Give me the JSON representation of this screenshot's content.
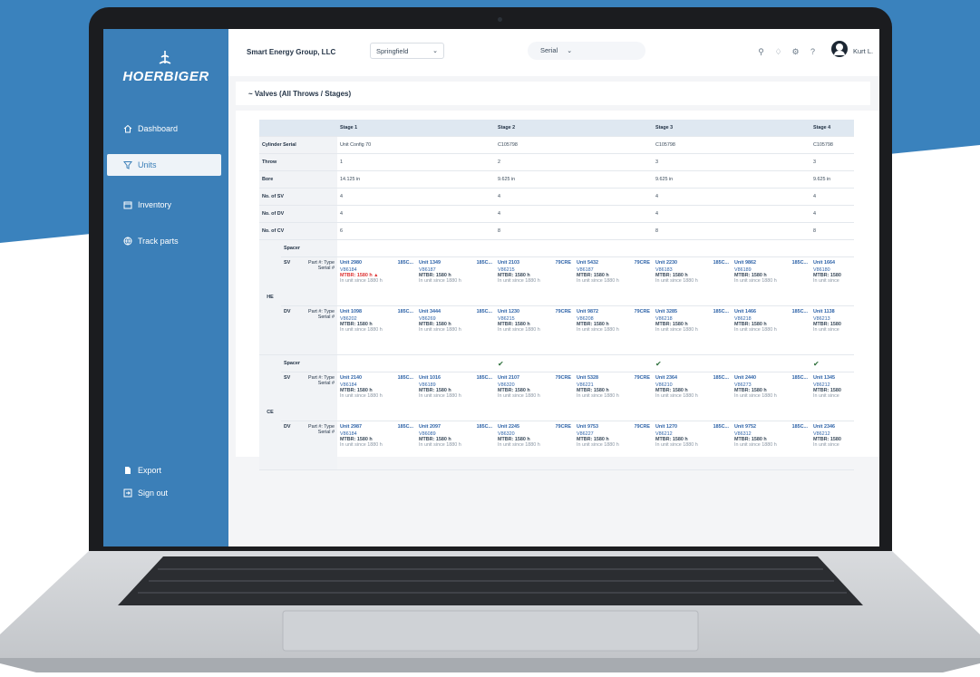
{
  "brand": {
    "name": "HOERBIGER"
  },
  "sidebar": {
    "items": [
      {
        "label": "Dashboard",
        "icon": "home-icon",
        "active": false
      },
      {
        "label": "Units",
        "icon": "filter-icon",
        "active": true
      },
      {
        "label": "Inventory",
        "icon": "calendar-icon",
        "active": false
      },
      {
        "label": "Track parts",
        "icon": "globe-icon",
        "active": false
      }
    ],
    "bottom": [
      {
        "label": "Export",
        "icon": "document-icon"
      },
      {
        "label": "Sign out",
        "icon": "sign-out-icon"
      }
    ]
  },
  "header": {
    "company": "Smart Energy Group, LLC",
    "location": "Springfield",
    "search_label": "Serial",
    "user_name": "Kurt L."
  },
  "section": {
    "title": "~ Valves (All Throws / Stages)"
  },
  "table": {
    "stages": [
      "Stage 1",
      "Stage 2",
      "Stage 3",
      "Stage 4"
    ],
    "rows": [
      {
        "label": "Cylinder Serial",
        "values": [
          "Unit Config 70",
          "C105798",
          "C105798",
          "C105798"
        ]
      },
      {
        "label": "Throw",
        "values": [
          "1",
          "2",
          "3",
          "3"
        ]
      },
      {
        "label": "Bore",
        "values": [
          "14.125 in",
          "9.625 in",
          "9.625 in",
          "9.625 in"
        ]
      },
      {
        "label": "No. of SV",
        "values": [
          "4",
          "4",
          "4",
          "4"
        ]
      },
      {
        "label": "No. of DV",
        "values": [
          "4",
          "4",
          "4",
          "4"
        ]
      },
      {
        "label": "No. of CV",
        "values": [
          "6",
          "8",
          "8",
          "8"
        ]
      }
    ],
    "spacer_label": "Spacer",
    "ends": [
      {
        "end": "HE",
        "spacer_checks": [
          false,
          false,
          false,
          false,
          false,
          false,
          false
        ],
        "valves": [
          {
            "type": "SV",
            "part_label": "Part #: Type",
            "serial_label": "Serial #",
            "cells": [
              {
                "unit": "Unit 2980",
                "code": "185C...",
                "serial": "V86184",
                "mtbr": "MTBR: 1580 h",
                "warn": true,
                "since": "In unit since 1880 h"
              },
              {
                "unit": "Unit 1349",
                "code": "185C...",
                "serial": "V86187",
                "mtbr": "MTBR: 1580 h",
                "warn": false,
                "since": "In unit since 1880 h"
              },
              {
                "unit": "Unit 2103",
                "code": "79CRE",
                "serial": "V86215",
                "mtbr": "MTBR: 1580 h",
                "warn": false,
                "since": "In unit since 1880 h"
              },
              {
                "unit": "Unit 5432",
                "code": "79CRE",
                "serial": "V86187",
                "mtbr": "MTBR: 1580 h",
                "warn": false,
                "since": "In unit since 1880 h"
              },
              {
                "unit": "Unit 2230",
                "code": "185C...",
                "serial": "V86183",
                "mtbr": "MTBR: 1580 h",
                "warn": false,
                "since": "In unit since 1880 h"
              },
              {
                "unit": "Unit 9862",
                "code": "185C...",
                "serial": "V86189",
                "mtbr": "MTBR: 1580 h",
                "warn": false,
                "since": "In unit since 1880 h"
              },
              {
                "unit": "Unit 1664",
                "code": "",
                "serial": "V86180",
                "mtbr": "MTBR: 1580",
                "warn": false,
                "since": "In unit since"
              }
            ]
          },
          {
            "type": "DV",
            "part_label": "Part #: Type",
            "serial_label": "Serial #",
            "cells": [
              {
                "unit": "Unit 1098",
                "code": "185C...",
                "serial": "V86202",
                "mtbr": "MTBR: 1580 h",
                "warn": false,
                "since": "In unit since 1880 h"
              },
              {
                "unit": "Unit 3444",
                "code": "185C...",
                "serial": "V86269",
                "mtbr": "MTBR: 1580 h",
                "warn": false,
                "since": "In unit since 1880 h"
              },
              {
                "unit": "Unit 1230",
                "code": "79CRE",
                "serial": "V86215",
                "mtbr": "MTBR: 1580 h",
                "warn": false,
                "since": "In unit since 1880 h"
              },
              {
                "unit": "Unit 9872",
                "code": "79CRE",
                "serial": "V86208",
                "mtbr": "MTBR: 1580 h",
                "warn": false,
                "since": "In unit since 1880 h"
              },
              {
                "unit": "Unit 3285",
                "code": "185C...",
                "serial": "V86218",
                "mtbr": "MTBR: 1580 h",
                "warn": false,
                "since": "In unit since 1880 h"
              },
              {
                "unit": "Unit 1466",
                "code": "185C...",
                "serial": "V86218",
                "mtbr": "MTBR: 1580 h",
                "warn": false,
                "since": "In unit since 1880 h"
              },
              {
                "unit": "Unit 1138",
                "code": "",
                "serial": "V86213",
                "mtbr": "MTBR: 1580",
                "warn": false,
                "since": "In unit since"
              }
            ]
          }
        ]
      },
      {
        "end": "CE",
        "spacer_checks": [
          false,
          false,
          true,
          false,
          true,
          false,
          true
        ],
        "valves": [
          {
            "type": "SV",
            "part_label": "Part #: Type",
            "serial_label": "Serial #",
            "cells": [
              {
                "unit": "Unit 2140",
                "code": "185C...",
                "serial": "V86184",
                "mtbr": "MTBR: 1580 h",
                "warn": false,
                "since": "In unit since 1880 h"
              },
              {
                "unit": "Unit 1016",
                "code": "185C...",
                "serial": "V86189",
                "mtbr": "MTBR: 1580 h",
                "warn": false,
                "since": "In unit since 1880 h"
              },
              {
                "unit": "Unit 2107",
                "code": "79CRE",
                "serial": "V86320",
                "mtbr": "MTBR: 1580 h",
                "warn": false,
                "since": "In unit since 1880 h"
              },
              {
                "unit": "Unit 5328",
                "code": "79CRE",
                "serial": "V86221",
                "mtbr": "MTBR: 1580 h",
                "warn": false,
                "since": "In unit since 1880 h"
              },
              {
                "unit": "Unit 2364",
                "code": "185C...",
                "serial": "V86210",
                "mtbr": "MTBR: 1580 h",
                "warn": false,
                "since": "In unit since 1880 h"
              },
              {
                "unit": "Unit 2440",
                "code": "185C...",
                "serial": "V86273",
                "mtbr": "MTBR: 1580 h",
                "warn": false,
                "since": "In unit since 1880 h"
              },
              {
                "unit": "Unit 1345",
                "code": "",
                "serial": "V86212",
                "mtbr": "MTBR: 1580",
                "warn": false,
                "since": "In unit since"
              }
            ]
          },
          {
            "type": "DV",
            "part_label": "Part #: Type",
            "serial_label": "Serial #",
            "cells": [
              {
                "unit": "Unit 2987",
                "code": "185C...",
                "serial": "V86184",
                "mtbr": "MTBR: 1580 h",
                "warn": false,
                "since": "In unit since 1880 h"
              },
              {
                "unit": "Unit 2097",
                "code": "185C...",
                "serial": "V86089",
                "mtbr": "MTBR: 1580 h",
                "warn": false,
                "since": "In unit since 1880 h"
              },
              {
                "unit": "Unit 2245",
                "code": "79CRE",
                "serial": "V86320",
                "mtbr": "MTBR: 1580 h",
                "warn": false,
                "since": "In unit since 1880 h"
              },
              {
                "unit": "Unit 9753",
                "code": "79CRE",
                "serial": "V86227",
                "mtbr": "MTBR: 1580 h",
                "warn": false,
                "since": "In unit since 1880 h"
              },
              {
                "unit": "Unit 1270",
                "code": "185C...",
                "serial": "V86212",
                "mtbr": "MTBR: 1580 h",
                "warn": false,
                "since": "In unit since 1880 h"
              },
              {
                "unit": "Unit 9752",
                "code": "185C...",
                "serial": "V86312",
                "mtbr": "MTBR: 1580 h",
                "warn": false,
                "since": "In unit since 1880 h"
              },
              {
                "unit": "Unit 2346",
                "code": "",
                "serial": "V86212",
                "mtbr": "MTBR: 1580",
                "warn": false,
                "since": "In unit since"
              }
            ]
          }
        ]
      }
    ]
  },
  "colors": {
    "background_blue": "#3a82bd",
    "sidebar": "#3b7fb8",
    "link_blue": "#2e63a8",
    "warning": "#d33333"
  }
}
